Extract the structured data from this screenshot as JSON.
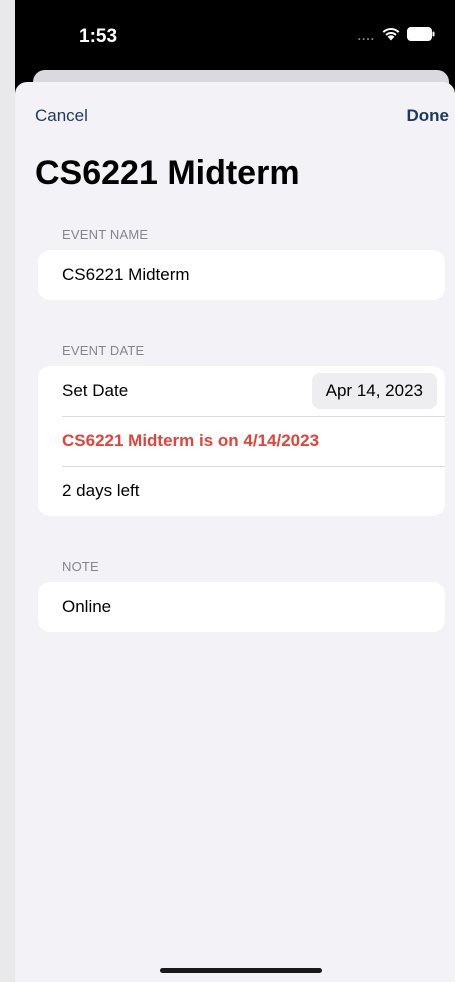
{
  "status_bar": {
    "time": "1:53",
    "signal": "....",
    "icons": [
      "wifi-icon",
      "battery-icon"
    ]
  },
  "nav": {
    "cancel_label": "Cancel",
    "done_label": "Done"
  },
  "title": "CS6221 Midterm",
  "sections": {
    "event_name": {
      "header": "EVENT NAME",
      "value": "CS6221 Midterm"
    },
    "event_date": {
      "header": "EVENT DATE",
      "set_date_label": "Set Date",
      "date_value": "Apr 14, 2023",
      "summary": "CS6221 Midterm is on 4/14/2023",
      "days_left": "2 days left"
    },
    "note": {
      "header": "NOTE",
      "value": "Online"
    }
  },
  "colors": {
    "accent": "#1c3a5e",
    "warning_text": "#e0443a",
    "background": "#f2f2f7"
  }
}
